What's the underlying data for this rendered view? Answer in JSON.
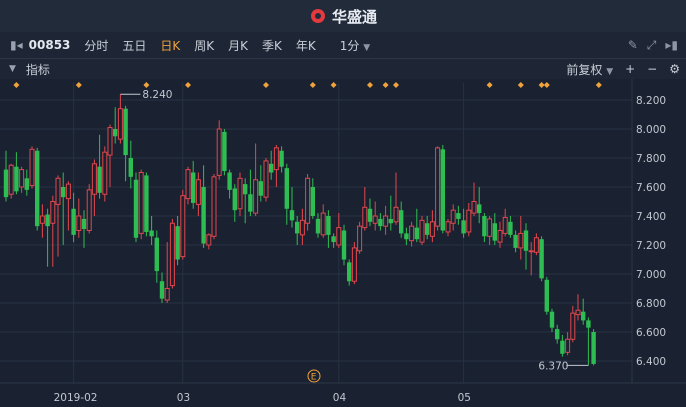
{
  "app": {
    "title": "华盛通"
  },
  "toolbar": {
    "stock_code": "00853",
    "periods": [
      "分时",
      "五日",
      "日K",
      "周K",
      "月K",
      "季K",
      "年K"
    ],
    "active_period": "日K",
    "interval": "1分"
  },
  "indicator_bar": {
    "label": "指标",
    "adjust": "前复权"
  },
  "chart_data": {
    "type": "candlestick",
    "ylim": [
      6.25,
      8.3
    ],
    "y_ticks": [
      "8.200",
      "8.000",
      "7.800",
      "7.600",
      "7.400",
      "7.200",
      "7.000",
      "6.800",
      "6.600",
      "6.400"
    ],
    "x_labels": [
      "2019-02",
      "03",
      "04",
      "05"
    ],
    "high_label": "8.240",
    "low_label": "6.370",
    "event_marker": "E",
    "colors": {
      "up": "#e0474c",
      "down": "#2ebd52",
      "marker": "#f0a23b"
    },
    "candles": [
      [
        7.72,
        7.53,
        7.85,
        7.5
      ],
      [
        7.55,
        7.75,
        7.76,
        7.52
      ],
      [
        7.74,
        7.57,
        7.84,
        7.55
      ],
      [
        7.6,
        7.72,
        7.74,
        7.56
      ],
      [
        7.66,
        7.58,
        7.72,
        7.54
      ],
      [
        7.61,
        7.86,
        7.88,
        7.59
      ],
      [
        7.85,
        7.33,
        7.87,
        7.3
      ],
      [
        7.35,
        7.4,
        7.48,
        7.25
      ],
      [
        7.41,
        7.33,
        7.45,
        7.05
      ],
      [
        7.35,
        7.5,
        7.54,
        7.05
      ],
      [
        7.48,
        7.66,
        7.68,
        7.12
      ],
      [
        7.6,
        7.53,
        7.7,
        7.2
      ],
      [
        7.52,
        7.62,
        7.64,
        7.3
      ],
      [
        7.45,
        7.27,
        7.56,
        7.22
      ],
      [
        7.3,
        7.4,
        7.52,
        7.25
      ],
      [
        7.38,
        7.31,
        7.44,
        7.18
      ],
      [
        7.3,
        7.58,
        7.62,
        7.28
      ],
      [
        7.55,
        7.76,
        7.79,
        7.4
      ],
      [
        7.74,
        7.56,
        7.96,
        7.52
      ],
      [
        7.55,
        7.84,
        7.88,
        7.5
      ],
      [
        7.82,
        8.01,
        8.03,
        7.6
      ],
      [
        8.0,
        7.95,
        8.15,
        7.9
      ],
      [
        7.93,
        8.14,
        8.24,
        7.9
      ],
      [
        8.14,
        7.82,
        8.16,
        7.64
      ],
      [
        7.8,
        7.67,
        7.92,
        7.59
      ],
      [
        7.65,
        7.25,
        7.7,
        7.22
      ],
      [
        7.28,
        7.7,
        7.72,
        7.24
      ],
      [
        7.68,
        7.29,
        7.7,
        7.26
      ],
      [
        7.3,
        7.26,
        7.4,
        7.2
      ],
      [
        7.25,
        7.02,
        7.3,
        6.94
      ],
      [
        6.95,
        6.83,
        7.01,
        6.8
      ],
      [
        6.82,
        6.9,
        7.22,
        6.8
      ],
      [
        6.92,
        7.35,
        7.38,
        6.9
      ],
      [
        7.33,
        7.1,
        7.4,
        7.06
      ],
      [
        7.12,
        7.54,
        7.58,
        7.1
      ],
      [
        7.52,
        7.72,
        7.74,
        7.48
      ],
      [
        7.7,
        7.49,
        7.78,
        7.45
      ],
      [
        7.48,
        7.65,
        7.7,
        7.4
      ],
      [
        7.6,
        7.21,
        7.75,
        7.18
      ],
      [
        7.2,
        7.27,
        7.28,
        7.17
      ],
      [
        7.26,
        7.67,
        7.69,
        7.24
      ],
      [
        7.68,
        8.0,
        8.06,
        7.65
      ],
      [
        7.98,
        7.71,
        8.0,
        7.68
      ],
      [
        7.7,
        7.58,
        7.72,
        7.52
      ],
      [
        7.59,
        7.44,
        7.62,
        7.36
      ],
      [
        7.45,
        7.66,
        7.7,
        7.4
      ],
      [
        7.62,
        7.55,
        7.66,
        7.35
      ],
      [
        7.55,
        7.43,
        7.72,
        7.4
      ],
      [
        7.42,
        7.65,
        7.9,
        7.4
      ],
      [
        7.64,
        7.54,
        7.75,
        7.5
      ],
      [
        7.53,
        7.78,
        7.8,
        7.5
      ],
      [
        7.76,
        7.7,
        7.85,
        7.65
      ],
      [
        7.72,
        7.87,
        7.89,
        7.6
      ],
      [
        7.85,
        7.74,
        7.88,
        7.7
      ],
      [
        7.73,
        7.45,
        7.76,
        7.34
      ],
      [
        7.44,
        7.37,
        7.6,
        7.32
      ],
      [
        7.36,
        7.28,
        7.4,
        7.2
      ],
      [
        7.27,
        7.37,
        7.45,
        7.2
      ],
      [
        7.35,
        7.66,
        7.69,
        7.3
      ],
      [
        7.6,
        7.4,
        7.66,
        7.38
      ],
      [
        7.38,
        7.28,
        7.42,
        7.25
      ],
      [
        7.27,
        7.42,
        7.48,
        7.25
      ],
      [
        7.4,
        7.27,
        7.44,
        7.18
      ],
      [
        7.26,
        7.22,
        7.28,
        7.18
      ],
      [
        7.2,
        7.32,
        7.42,
        7.18
      ],
      [
        7.3,
        7.1,
        7.34,
        7.06
      ],
      [
        7.08,
        6.95,
        7.1,
        6.92
      ],
      [
        6.95,
        7.18,
        7.22,
        6.93
      ],
      [
        7.16,
        7.33,
        7.36,
        7.14
      ],
      [
        7.32,
        7.46,
        7.6,
        7.3
      ],
      [
        7.45,
        7.36,
        7.52,
        7.33
      ],
      [
        7.35,
        7.4,
        7.5,
        7.3
      ],
      [
        7.38,
        7.33,
        7.42,
        7.3
      ],
      [
        7.33,
        7.4,
        7.47,
        7.27
      ],
      [
        7.38,
        7.35,
        7.54,
        7.3
      ],
      [
        7.36,
        7.46,
        7.7,
        7.34
      ],
      [
        7.44,
        7.28,
        7.5,
        7.25
      ],
      [
        7.28,
        7.24,
        7.32,
        7.2
      ],
      [
        7.23,
        7.33,
        7.36,
        7.19
      ],
      [
        7.32,
        7.24,
        7.45,
        7.22
      ],
      [
        7.22,
        7.37,
        7.4,
        7.2
      ],
      [
        7.35,
        7.27,
        7.4,
        7.24
      ],
      [
        7.26,
        7.36,
        7.44,
        7.22
      ],
      [
        7.33,
        7.87,
        7.88,
        7.3
      ],
      [
        7.86,
        7.3,
        7.89,
        7.28
      ],
      [
        7.29,
        7.36,
        7.38,
        7.26
      ],
      [
        7.35,
        7.44,
        7.48,
        7.3
      ],
      [
        7.42,
        7.38,
        7.47,
        7.34
      ],
      [
        7.37,
        7.28,
        7.45,
        7.25
      ],
      [
        7.29,
        7.44,
        7.49,
        7.26
      ],
      [
        7.42,
        7.5,
        7.63,
        7.4
      ],
      [
        7.48,
        7.42,
        7.6,
        7.35
      ],
      [
        7.4,
        7.26,
        7.42,
        7.22
      ],
      [
        7.26,
        7.38,
        7.4,
        7.2
      ],
      [
        7.35,
        7.23,
        7.42,
        7.2
      ],
      [
        7.22,
        7.3,
        7.36,
        7.18
      ],
      [
        7.28,
        7.39,
        7.45,
        7.26
      ],
      [
        7.36,
        7.27,
        7.4,
        7.25
      ],
      [
        7.27,
        7.18,
        7.3,
        7.15
      ],
      [
        7.18,
        7.28,
        7.4,
        7.1
      ],
      [
        7.3,
        7.16,
        7.35,
        7.03
      ],
      [
        7.16,
        7.16,
        7.22,
        6.99
      ],
      [
        7.15,
        7.25,
        7.28,
        7.13
      ],
      [
        7.24,
        6.97,
        7.26,
        6.95
      ],
      [
        6.96,
        6.74,
        6.98,
        6.72
      ],
      [
        6.74,
        6.63,
        6.76,
        6.6
      ],
      [
        6.62,
        6.55,
        6.65,
        6.52
      ],
      [
        6.54,
        6.45,
        6.58,
        6.43
      ],
      [
        6.46,
        6.55,
        6.6,
        6.44
      ],
      [
        6.55,
        6.73,
        6.78,
        6.53
      ],
      [
        6.72,
        6.75,
        6.86,
        6.68
      ],
      [
        6.74,
        6.68,
        6.83,
        6.65
      ],
      [
        6.68,
        6.63,
        6.7,
        6.37
      ],
      [
        6.6,
        6.38,
        6.62,
        6.37
      ]
    ],
    "marker_indices": [
      2,
      14,
      27,
      35,
      50,
      59,
      63,
      70,
      73,
      75,
      93,
      99,
      103,
      104,
      114
    ]
  }
}
